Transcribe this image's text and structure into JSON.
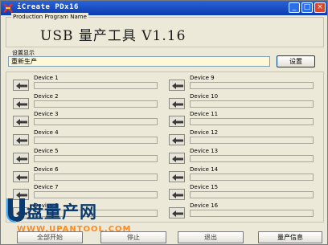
{
  "window": {
    "title": "iCreate PDx16",
    "min_label": "_",
    "max_label": "□",
    "close_label": "×"
  },
  "production": {
    "group_label": "Production Program Name",
    "banner": "USB 量产工具 V1.16"
  },
  "settings": {
    "group_label": "设置显示",
    "value": "重新生产",
    "button_label": "设置"
  },
  "devices": [
    {
      "label": "Device 1"
    },
    {
      "label": "Device 2"
    },
    {
      "label": "Device 3"
    },
    {
      "label": "Device 4"
    },
    {
      "label": "Device 5"
    },
    {
      "label": "Device 6"
    },
    {
      "label": "Device 7"
    },
    {
      "label": "Device 8"
    },
    {
      "label": "Device 9"
    },
    {
      "label": "Device 10"
    },
    {
      "label": "Device 11"
    },
    {
      "label": "Device 12"
    },
    {
      "label": "Device 13"
    },
    {
      "label": "Device 14"
    },
    {
      "label": "Device 15"
    },
    {
      "label": "Device 16"
    }
  ],
  "bottom_buttons": {
    "b1": "全部开始",
    "b2": "停止",
    "b3": "退出",
    "b4": "量产信息"
  },
  "watermark": {
    "text": "盘量产网",
    "url": "WWW.UPANTOOL.COM"
  },
  "colors": {
    "titlebar": "#0a3cb0",
    "window_bg": "#ece9d8",
    "field_bg": "#fff8d6"
  }
}
